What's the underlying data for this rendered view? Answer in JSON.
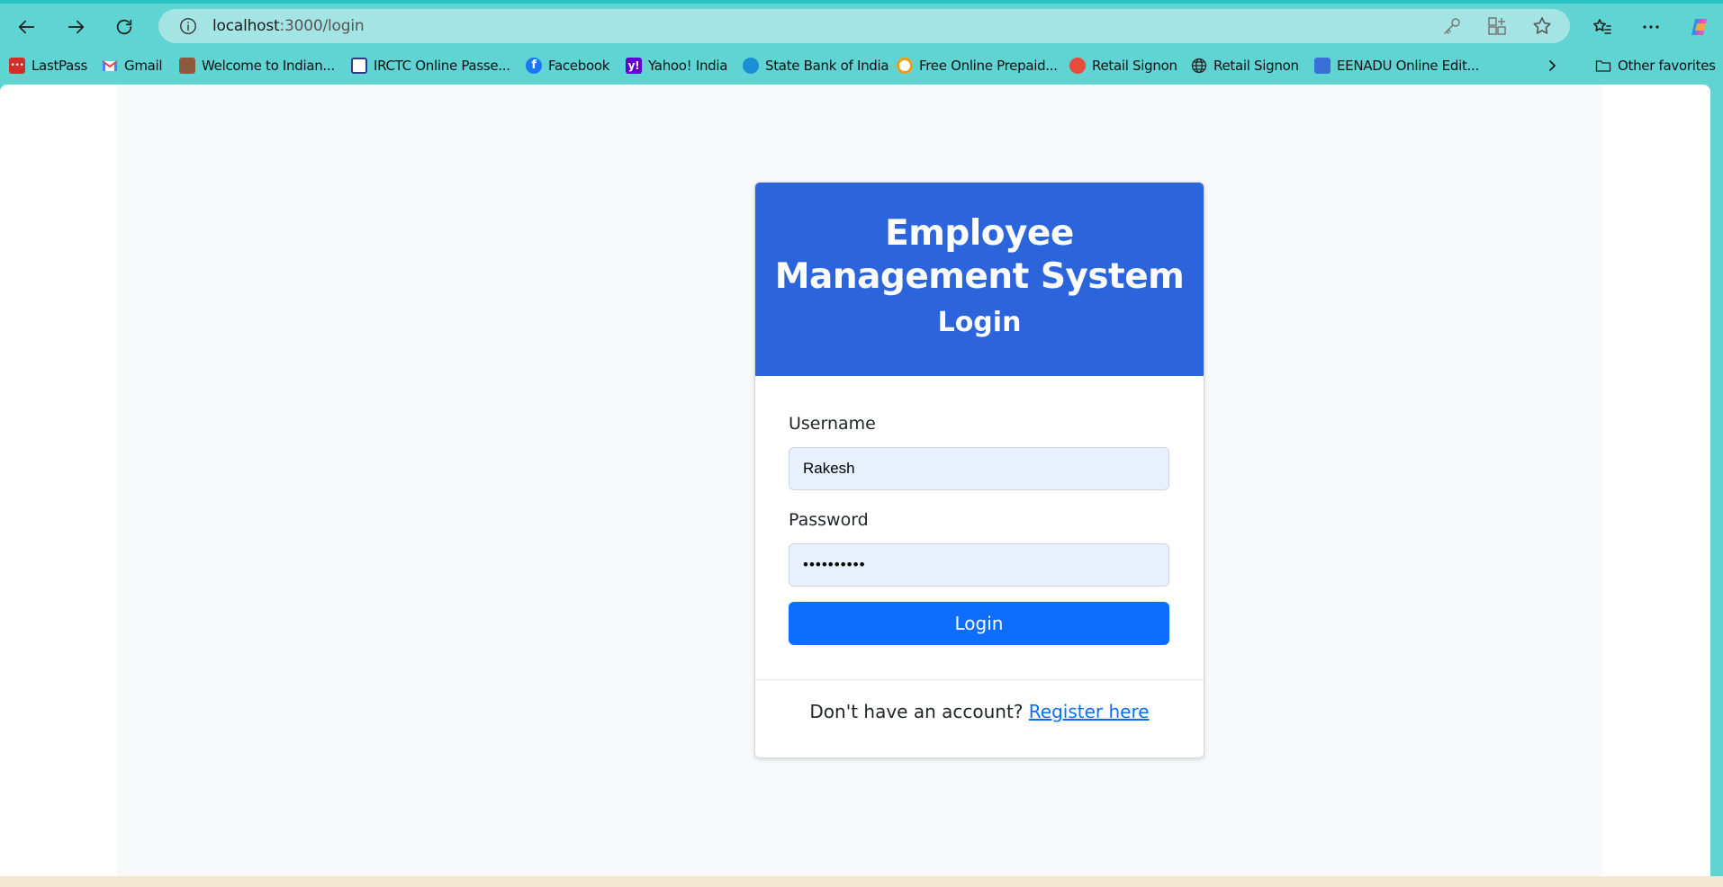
{
  "browser": {
    "url_host": "localhost",
    "url_path": ":3000/login",
    "accent_color": "#60d3d3"
  },
  "bookmarks": {
    "items": [
      {
        "label": "LastPass",
        "icon": "lastpass-icon",
        "color": "#d32d27"
      },
      {
        "label": "Gmail",
        "icon": "gmail-icon",
        "color": "#ea4335"
      },
      {
        "label": "Welcome to Indian...",
        "icon": "indian-rail-icon",
        "color": "#8b5a3c"
      },
      {
        "label": "IRCTC Online Passe...",
        "icon": "irctc-icon",
        "color": "#2d3a8c"
      },
      {
        "label": "Facebook",
        "icon": "facebook-icon",
        "color": "#1877f2"
      },
      {
        "label": "Yahoo! India",
        "icon": "yahoo-icon",
        "color": "#6001d2"
      },
      {
        "label": "State Bank of India",
        "icon": "sbi-icon",
        "color": "#1a8fd6"
      },
      {
        "label": "Free Online Prepaid...",
        "icon": "prepaid-icon",
        "color": "#f39c12"
      },
      {
        "label": "Retail Signon",
        "icon": "retail-signon-icon",
        "color": "#e74c3c"
      },
      {
        "label": "Retail Signon",
        "icon": "globe-icon",
        "color": "#333333"
      },
      {
        "label": "EENADU Online Edit...",
        "icon": "eenadu-icon",
        "color": "#3a6fd8"
      }
    ],
    "other_favorites": "Other favorites"
  },
  "card": {
    "title": "Employee Management System",
    "subtitle": "Login",
    "header_color": "#2b64db"
  },
  "form": {
    "username_label": "Username",
    "username_value": "Rakesh",
    "password_label": "Password",
    "password_value": "••••••••••",
    "submit_label": "Login",
    "button_color": "#0d6efd"
  },
  "footer": {
    "prompt": "Don't have an account?",
    "link": "Register here"
  }
}
